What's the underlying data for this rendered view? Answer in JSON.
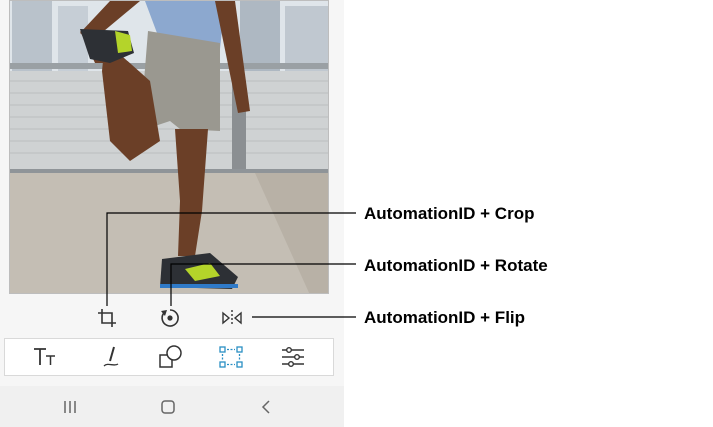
{
  "callouts": {
    "crop": "AutomationID + Crop",
    "rotate": "AutomationID + Rotate",
    "flip": "AutomationID + Flip"
  },
  "edit_icons": [
    "crop-icon",
    "rotate-icon",
    "flip-icon"
  ],
  "toolbar_icons": [
    "text-icon",
    "draw-icon",
    "shapes-icon",
    "transform-icon",
    "adjust-icon"
  ],
  "toolbar_selected": "transform-icon",
  "nav_icons": [
    "recent-apps-icon",
    "home-icon",
    "back-icon"
  ],
  "colors": {
    "accent": "#2a8fc4",
    "icon": "#333333",
    "line": "#000000"
  }
}
